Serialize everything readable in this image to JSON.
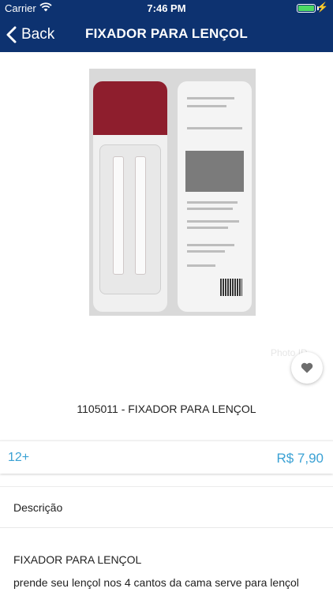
{
  "status_bar": {
    "carrier": "Carrier",
    "time": "7:46 PM"
  },
  "nav": {
    "back_label": "Back",
    "title": "FIXADOR PARA LENÇOL"
  },
  "product": {
    "watermark": "Photo ID",
    "name": "1105011 - FIXADOR PARA LENÇOL",
    "installments": "12+",
    "price": "R$ 7,90"
  },
  "description": {
    "header": "Descrição",
    "title": "FIXADOR PARA LENÇOL",
    "text": "prende seu lençol nos 4 cantos da cama serve para lençol"
  },
  "colors": {
    "header_bg": "#0d3270",
    "accent": "#3aa1d4",
    "battery": "#4cd964"
  },
  "icons": [
    "wifi-icon",
    "battery-icon",
    "charging-icon",
    "back-chevron-icon",
    "heart-icon"
  ]
}
